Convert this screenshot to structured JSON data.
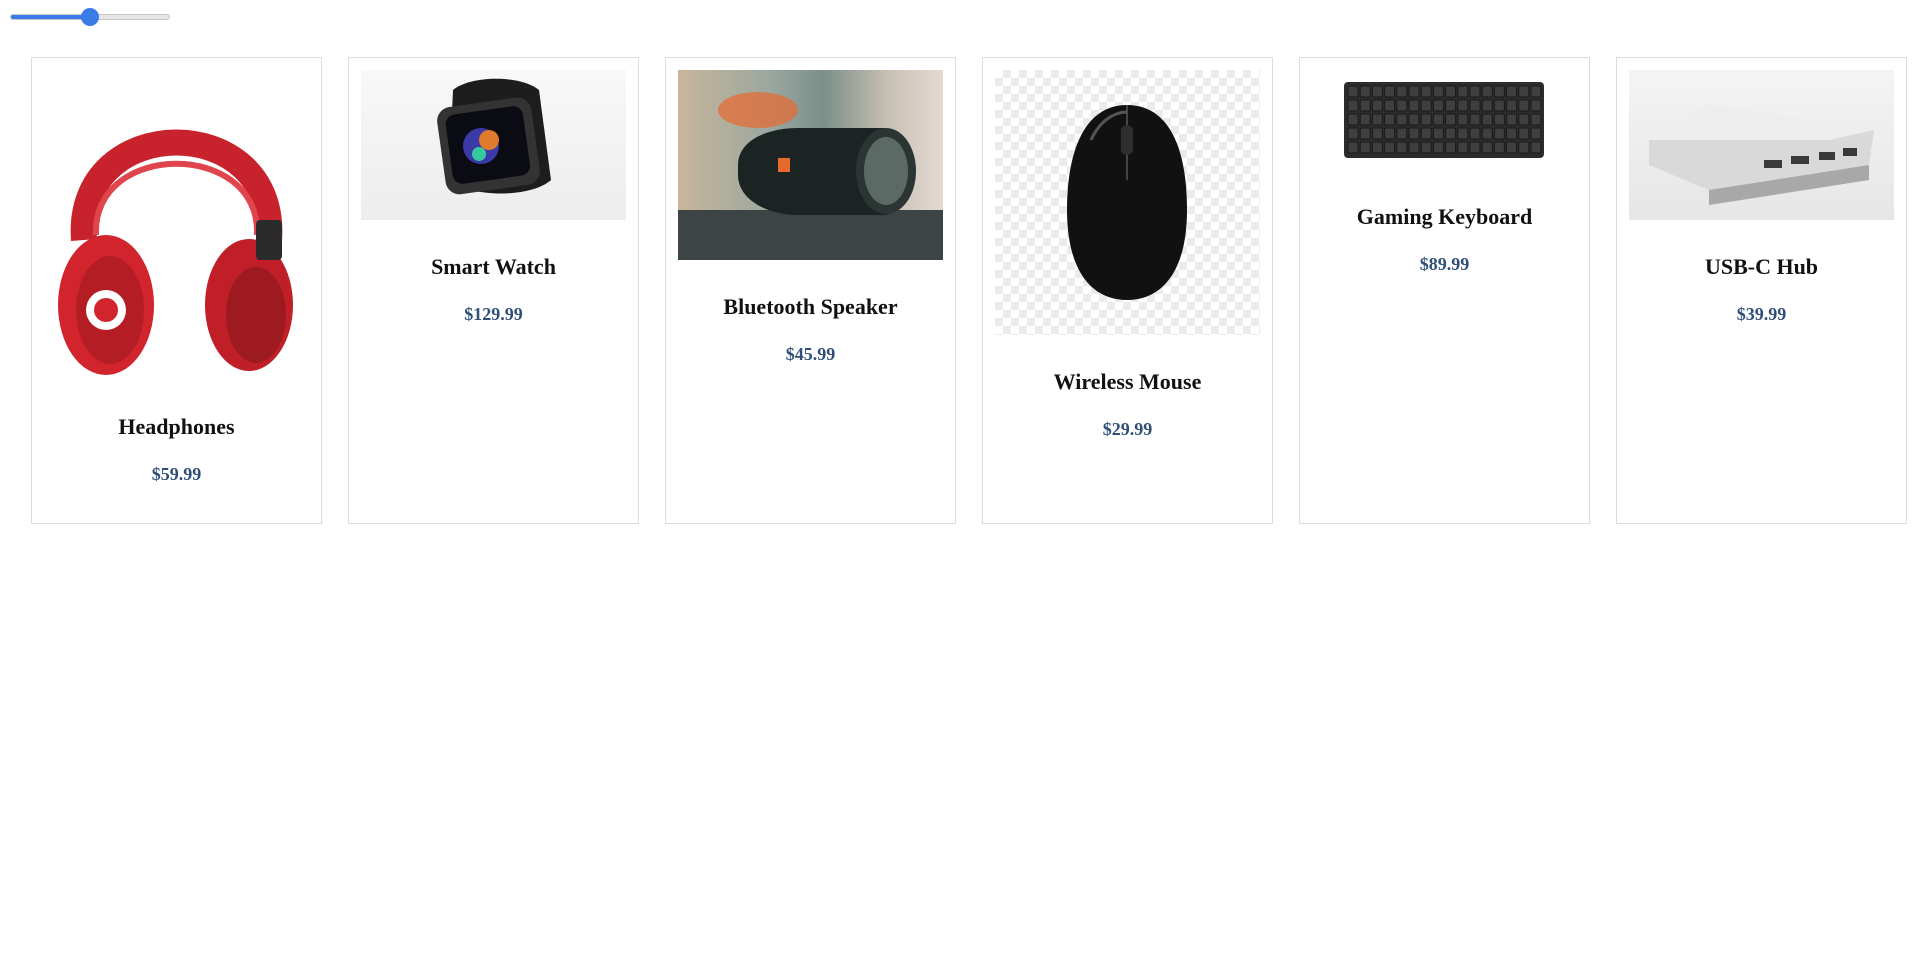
{
  "slider": {
    "value": 0.5,
    "accent": "#3b7be8"
  },
  "products": [
    {
      "name": "Headphones",
      "price": "$59.99",
      "image_icon": "headphones-image"
    },
    {
      "name": "Smart Watch",
      "price": "$129.99",
      "image_icon": "smart-watch-image"
    },
    {
      "name": "Bluetooth Speaker",
      "price": "$45.99",
      "image_icon": "bluetooth-speaker-image"
    },
    {
      "name": "Wireless Mouse",
      "price": "$29.99",
      "image_icon": "wireless-mouse-image"
    },
    {
      "name": "Gaming Keyboard",
      "price": "$89.99",
      "image_icon": "gaming-keyboard-image"
    },
    {
      "name": "USB-C Hub",
      "price": "$39.99",
      "image_icon": "usb-c-hub-image"
    }
  ],
  "colors": {
    "price": "#2f4e78",
    "card_border": "#dddddd"
  }
}
